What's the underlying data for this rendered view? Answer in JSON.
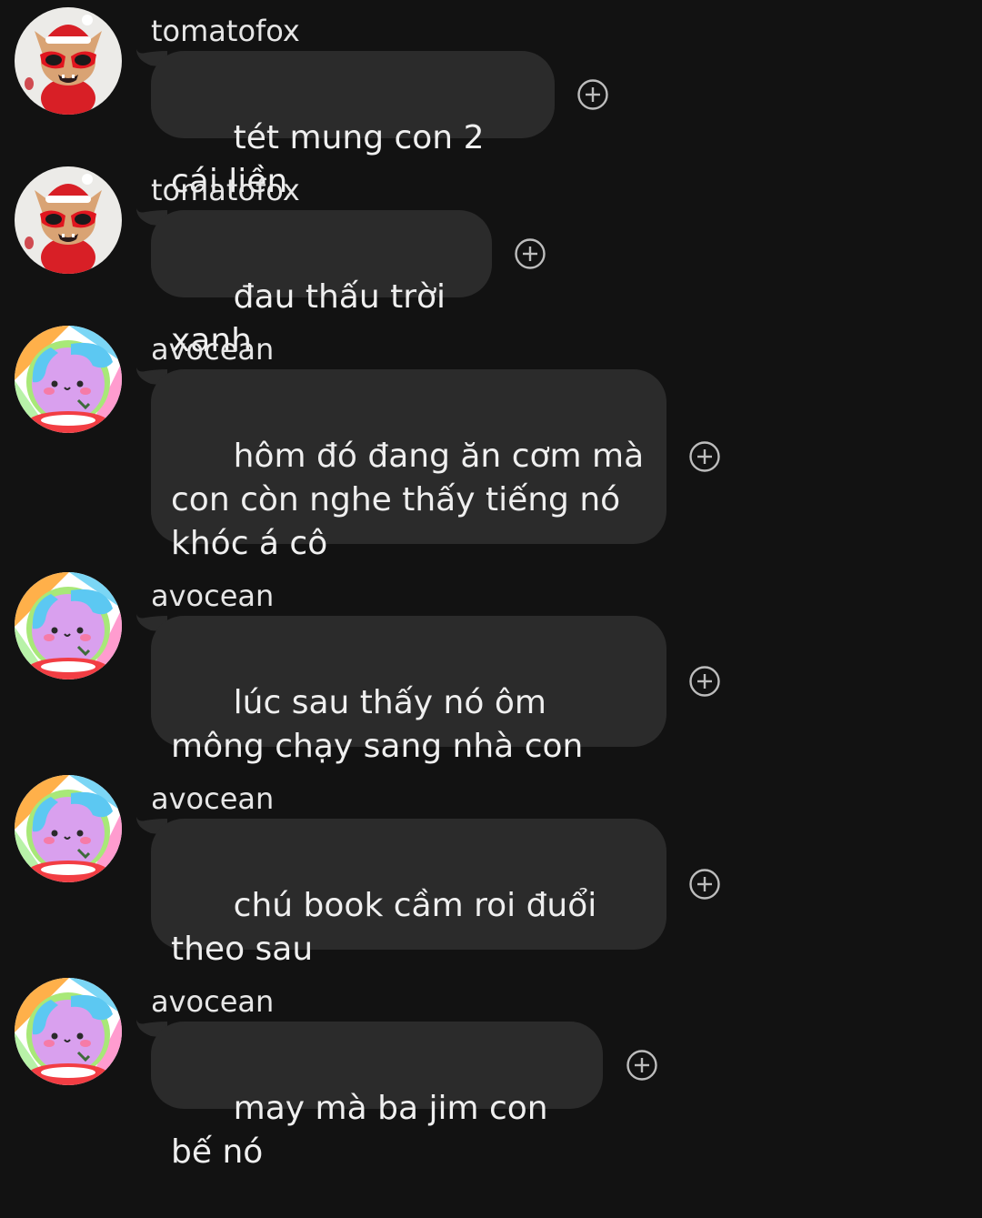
{
  "messages": [
    {
      "username": "tomatofox",
      "text": "tét mung con 2 cái liền",
      "avatar": "tomatofox-avatar"
    },
    {
      "username": "tomatofox",
      "text": "đau thấu trời xanh",
      "avatar": "tomatofox-avatar"
    },
    {
      "username": "avocean",
      "text": "hôm đó đang ăn cơm mà con còn nghe thấy tiếng nó khóc á cô",
      "avatar": "avocean-avatar"
    },
    {
      "username": "avocean",
      "text": "lúc sau thấy nó ôm mông chạy sang nhà con",
      "avatar": "avocean-avatar"
    },
    {
      "username": "avocean",
      "text": "chú book cầm roi đuổi theo sau",
      "avatar": "avocean-avatar"
    },
    {
      "username": "avocean",
      "text": "may mà ba jim con bế nó",
      "avatar": "avocean-avatar"
    }
  ],
  "icons": {
    "reaction": "add-reaction-icon"
  },
  "colors": {
    "background": "#121212",
    "bubble": "#2b2b2b",
    "text": "#efefef",
    "username": "#e6e6e6",
    "reaction_icon": "#bdbdbd"
  }
}
